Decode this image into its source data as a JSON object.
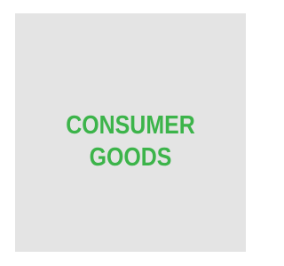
{
  "tile": {
    "label_line1": "CONSUMER",
    "label_line2": "GOODS",
    "colors": {
      "background": "#e4e4e4",
      "text": "#3cb44a"
    }
  }
}
